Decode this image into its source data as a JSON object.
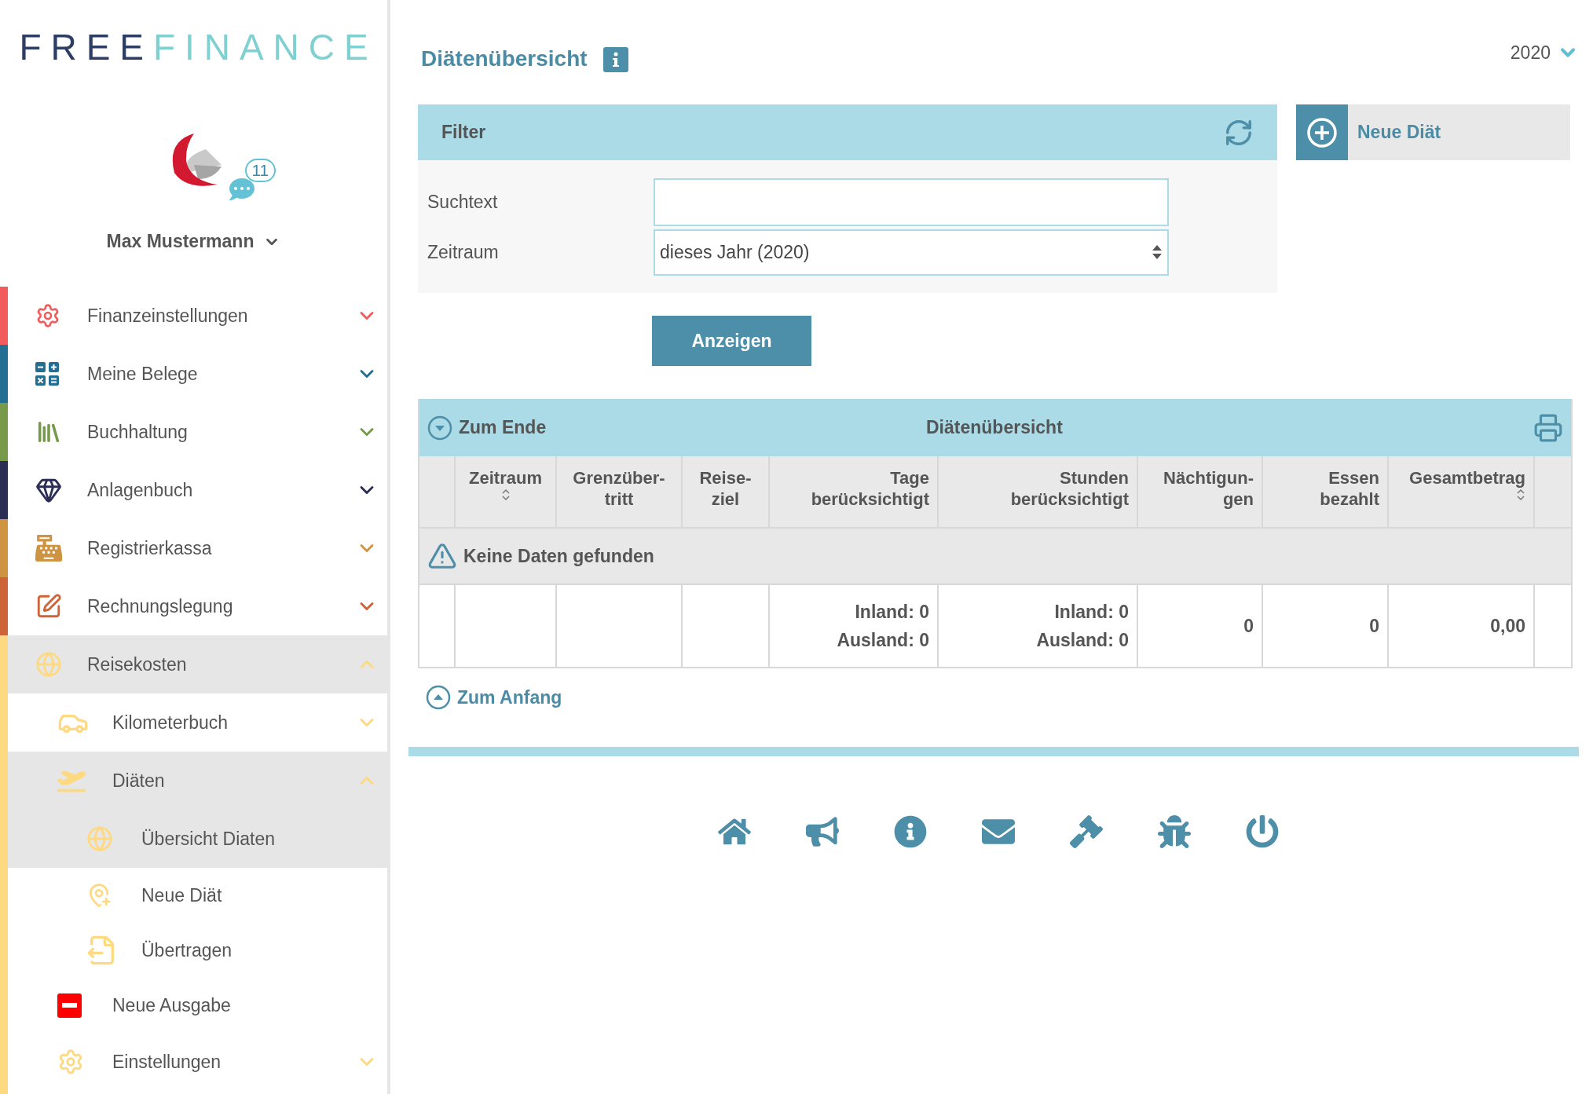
{
  "logo": {
    "part_1": "FREE",
    "part_2": "FINANCE"
  },
  "user": {
    "name": "Max Mustermann",
    "message_count": "11"
  },
  "sidebar": {
    "items": [
      {
        "label": "Finanzeinstellungen",
        "color": "#f25c5c",
        "expanded": false,
        "selected": false
      },
      {
        "label": "Meine Belege",
        "color": "#236f93",
        "expanded": false,
        "selected": false
      },
      {
        "label": "Buchhaltung",
        "color": "#77994a",
        "expanded": false,
        "selected": false
      },
      {
        "label": "Anlagenbuch",
        "color": "#2b2d55",
        "expanded": false,
        "selected": false
      },
      {
        "label": "Registrierkassa",
        "color": "#cf9442",
        "expanded": false,
        "selected": false
      },
      {
        "label": "Rechnungslegung",
        "color": "#cf6338",
        "expanded": false,
        "selected": false
      },
      {
        "label": "Reisekosten",
        "color": "#fdd982",
        "expanded": true,
        "selected": true,
        "children": [
          {
            "label": "Kilometerbuch",
            "kind": "group",
            "expanded": false,
            "selected": false
          },
          {
            "label": "Diäten",
            "kind": "group",
            "expanded": true,
            "selected": true,
            "children": [
              {
                "label": "Übersicht Diaten",
                "selected": true
              },
              {
                "label": "Neue Diät",
                "selected": false
              },
              {
                "label": "Übertragen",
                "selected": false
              }
            ]
          },
          {
            "label": "Neue Ausgabe",
            "kind": "link",
            "selected": false
          },
          {
            "label": "Einstellungen",
            "kind": "group",
            "expanded": false,
            "selected": false
          }
        ]
      }
    ]
  },
  "page": {
    "title": "Diätenübersicht",
    "year": "2020"
  },
  "filter": {
    "title": "Filter",
    "fields": [
      {
        "label": "Suchtext",
        "kind": "text"
      },
      {
        "label": "Zeitraum",
        "kind": "select",
        "value": "dieses Jahr (2020)"
      }
    ],
    "submit": "Anzeigen"
  },
  "new_button": "Neue Diät",
  "table": {
    "to_end": "Zum Ende",
    "title": "Diätenübersicht",
    "columns": [
      {
        "label": "Zeitraum",
        "sortable": true
      },
      {
        "label": "Grenzüber-\ntritt",
        "sortable": false
      },
      {
        "label": "Reise-\nziel",
        "sortable": false
      },
      {
        "label": "Tage\nberücksichtigt",
        "sortable": false
      },
      {
        "label": "Stunden\nberücksichtigt",
        "sortable": false
      },
      {
        "label": "Nächtigun-\ngen",
        "sortable": false
      },
      {
        "label": "Essen\nbezahlt",
        "sortable": false
      },
      {
        "label": "Gesamtbetrag",
        "sortable": true
      }
    ],
    "empty_message": "Keine Daten gefunden",
    "totals": {
      "days": [
        "Inland: 0",
        "Ausland: 0"
      ],
      "hours": [
        "Inland: 0",
        "Ausland: 0"
      ],
      "nights": "0",
      "meals": "0",
      "total": "0,00"
    },
    "to_start": "Zum Anfang"
  }
}
